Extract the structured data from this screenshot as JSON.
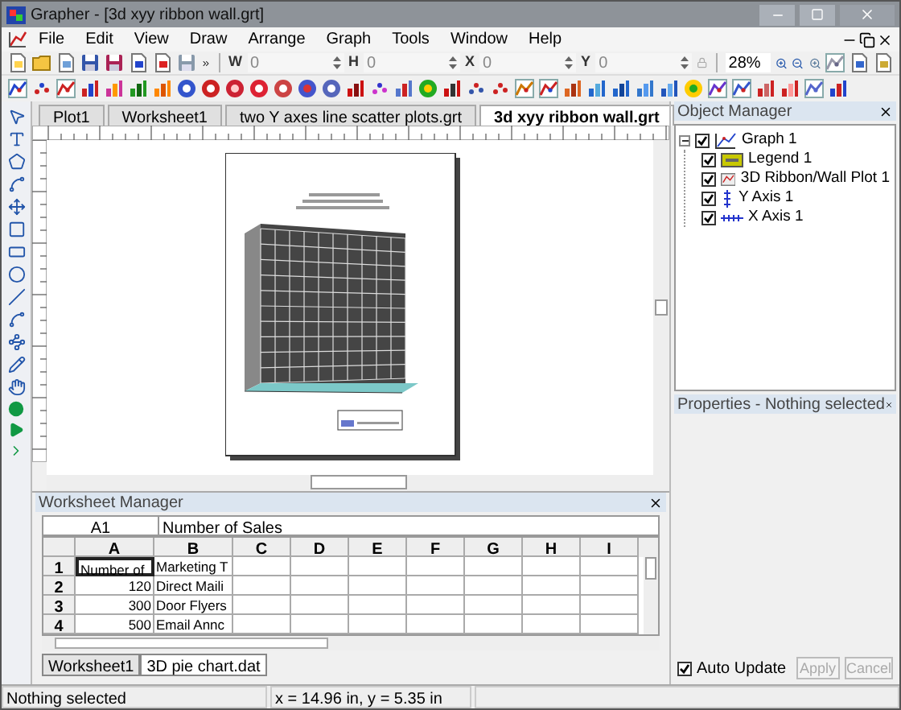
{
  "window": {
    "title": "Grapher - [3d xyy ribbon wall.grt]"
  },
  "menu": [
    "File",
    "Edit",
    "View",
    "Draw",
    "Arrange",
    "Graph",
    "Tools",
    "Window",
    "Help"
  ],
  "toolbar": {
    "fields": [
      {
        "label": "W",
        "value": "0"
      },
      {
        "label": "H",
        "value": "0"
      },
      {
        "label": "X",
        "value": "0"
      },
      {
        "label": "Y",
        "value": "0"
      }
    ],
    "zoom": "28%"
  },
  "tabs": [
    {
      "label": "Plot1",
      "selected": false
    },
    {
      "label": "Worksheet1",
      "selected": false
    },
    {
      "label": "two Y axes line scatter plots.grt",
      "selected": false
    },
    {
      "label": "3d xyy ribbon wall.grt",
      "selected": true
    }
  ],
  "object_manager": {
    "title": "Object Manager",
    "tree": [
      {
        "label": "Graph 1",
        "kind": "graph",
        "checked": true,
        "expanded": true,
        "children": [
          {
            "label": "Legend 1",
            "kind": "legend",
            "checked": true
          },
          {
            "label": "3D Ribbon/Wall Plot 1",
            "kind": "plot",
            "checked": true
          },
          {
            "label": "Y Axis 1",
            "kind": "y_axis",
            "checked": true
          },
          {
            "label": "X Axis 1",
            "kind": "x_axis",
            "checked": true
          }
        ]
      }
    ]
  },
  "properties": {
    "title": "Properties - Nothing selected",
    "auto_update": {
      "label": "Auto Update",
      "checked": true
    },
    "buttons": [
      {
        "label": "Apply",
        "disabled": true
      },
      {
        "label": "Cancel",
        "disabled": true
      }
    ]
  },
  "worksheet_manager": {
    "title": "Worksheet Manager",
    "cell_ref": "A1",
    "cell_value": "Number of Sales",
    "columns": [
      "A",
      "B",
      "C",
      "D",
      "E",
      "F",
      "G",
      "H",
      "I"
    ],
    "rows": [
      {
        "header": "1",
        "cells": [
          "Number of",
          "Marketing T"
        ]
      },
      {
        "header": "2",
        "cells": [
          "120",
          "Direct Maili"
        ]
      },
      {
        "header": "3",
        "cells": [
          "300",
          "Door Flyers"
        ]
      },
      {
        "header": "4",
        "cells": [
          "500",
          "Email Annc"
        ]
      }
    ],
    "sheets": [
      {
        "label": "Worksheet1",
        "selected": false
      },
      {
        "label": "3D pie chart.dat",
        "selected": true
      }
    ]
  },
  "status_bar": [
    "Nothing selected",
    "x = 14.96 in, y = 5.35 in"
  ]
}
